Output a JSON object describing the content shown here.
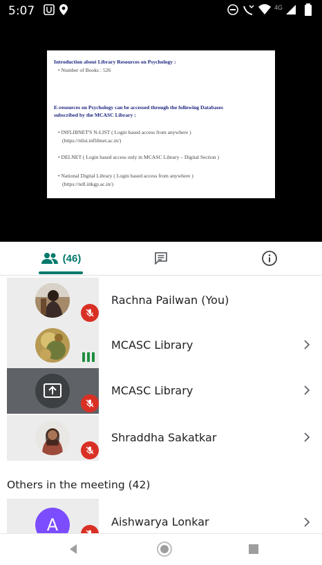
{
  "status": {
    "time": "5:07",
    "network": "4G"
  },
  "slide": {
    "heading": "Introduction about Library Resources on Psychology :",
    "books": "• Number of Books : 526",
    "eresources_line1": "E-resources on Psychology can be accessed through the following Databases",
    "eresources_line2": "subscribed by the MCASC Library :",
    "item1_line1": "• INFLIBNET'S N-LIST ( Login based access from anywhere )",
    "item1_line2": "(https://nlist.inflibnet.ac.in/)",
    "item2_line1": "• DELNET ( Login based access only in MCASC Library – Digital Section )",
    "item3_line1": "• National Digital Library ( Login based access from anywhere )",
    "item3_line2": "(https://ndl.iitkgp.ac.in/)"
  },
  "tabs": {
    "people_count": "(46)"
  },
  "participants": [
    {
      "name": "Rachna Pailwan (You)"
    },
    {
      "name": "MCASC Library"
    },
    {
      "name": "MCASC Library"
    },
    {
      "name": "Shraddha Sakatkar"
    }
  ],
  "others": {
    "title": "Others in the meeting (42)",
    "first": {
      "initial": "A",
      "name": "Aishwarya Lonkar"
    }
  },
  "colors": {
    "accent": "#00796b",
    "mute": "#d93025",
    "speaking": "#1e8e3e",
    "avatar_letter_bg": "#7c4dff"
  },
  "icons": {
    "people": "people-icon",
    "chat": "chat-icon",
    "info": "info-icon",
    "mic_off": "mic-off-icon",
    "chevron": "chevron-right-icon",
    "present": "present-screen-icon"
  }
}
